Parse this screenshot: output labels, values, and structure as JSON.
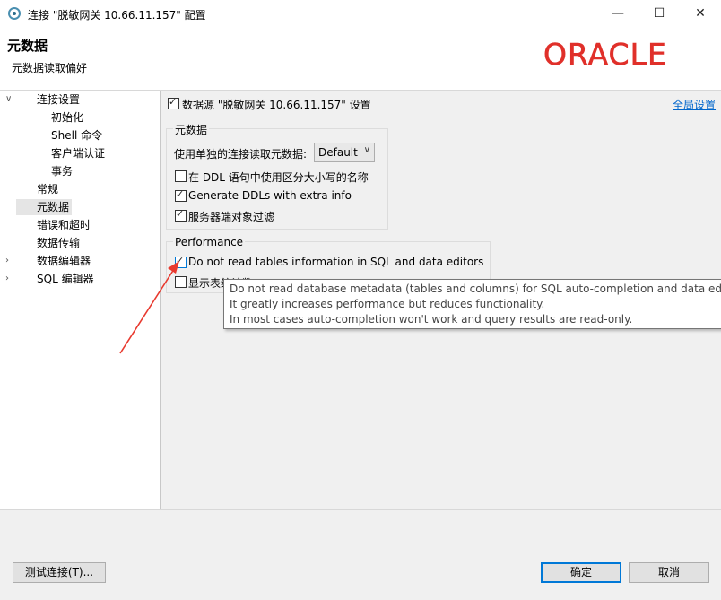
{
  "window": {
    "title": "连接 \"脱敏网关 10.66.11.157\" 配置",
    "minimize_icon": "minimize-icon",
    "maximize_icon": "maximize-icon",
    "close_icon": "close-icon"
  },
  "header": {
    "title": "元数据",
    "subtitle": "元数据读取偏好",
    "logo_text": "ORACLE"
  },
  "tree": {
    "items": [
      {
        "label": "连接设置",
        "expanded": true
      },
      {
        "label": "初始化"
      },
      {
        "label": "Shell 命令"
      },
      {
        "label": "客户端认证"
      },
      {
        "label": "事务"
      },
      {
        "label": "常规"
      },
      {
        "label": "元数据",
        "selected": true
      },
      {
        "label": "错误和超时"
      },
      {
        "label": "数据传输"
      },
      {
        "label": "数据编辑器",
        "expandable": true
      },
      {
        "label": "SQL 编辑器",
        "expandable": true
      }
    ]
  },
  "panel": {
    "datasource_label": "数据源 \"脱敏网关 10.66.11.157\" 设置",
    "datasource_checked": true,
    "global_settings_link": "全局设置",
    "metadata_group": {
      "title": "元数据",
      "separate_conn_label": "使用单独的连接读取元数据:",
      "separate_conn_value": "Default",
      "options": [
        {
          "label": "在 DDL 语句中使用区分大小写的名称",
          "checked": false
        },
        {
          "label": "Generate DDLs with extra info",
          "checked": true
        },
        {
          "label": "服务器端对象过滤",
          "checked": true
        }
      ]
    },
    "performance_group": {
      "title": "Performance",
      "options": [
        {
          "label": "Do not read tables information in SQL and data editors",
          "checked": true
        },
        {
          "label": "显示表统计数",
          "checked": false
        }
      ]
    }
  },
  "tooltip": {
    "lines": [
      "Do not read database metadata (tables and columns) for SQL auto-completion and data edito",
      "It greatly increases performance but reduces functionality.",
      "In most cases auto-completion won't work and query results are read-only."
    ]
  },
  "footer": {
    "test_button": "测试连接(T)...",
    "ok_button": "确定",
    "cancel_button": "取消"
  },
  "colors": {
    "oracle_red": "#e0302a",
    "link_blue": "#0066cc",
    "focus_blue": "#0078d7",
    "annotation_arrow": "#e8392e"
  }
}
